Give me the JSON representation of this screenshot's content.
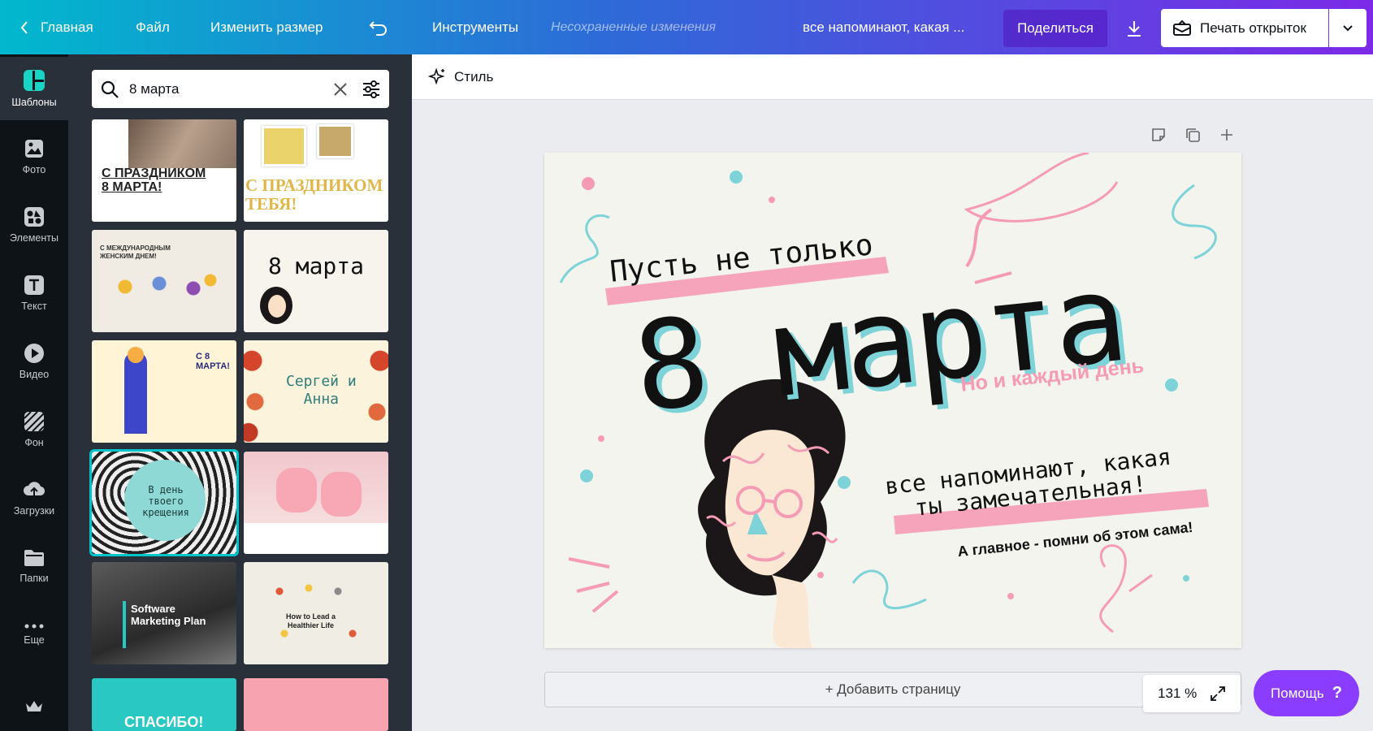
{
  "topbar": {
    "home": "Главная",
    "file": "Файл",
    "resize": "Изменить размер",
    "tools": "Инструменты",
    "unsaved": "Несохраненные изменения",
    "doc_title": "все напоминают, какая ...",
    "share": "Поделиться",
    "print": "Печать открыток",
    "colors": {
      "gradient_start": "#01b8cd",
      "gradient_end": "#7c2ae8"
    }
  },
  "rail": [
    {
      "label": "Шаблоны",
      "icon": "templates-icon"
    },
    {
      "label": "Фото",
      "icon": "photo-icon"
    },
    {
      "label": "Элементы",
      "icon": "elements-icon"
    },
    {
      "label": "Текст",
      "icon": "text-icon"
    },
    {
      "label": "Видео",
      "icon": "video-icon"
    },
    {
      "label": "Фон",
      "icon": "background-icon"
    },
    {
      "label": "Загрузки",
      "icon": "upload-icon"
    },
    {
      "label": "Папки",
      "icon": "folder-icon"
    },
    {
      "label": "Еще",
      "icon": "more-icon"
    }
  ],
  "search": {
    "value": "8 марта"
  },
  "templates": [
    {
      "text1": "С ПРАЗДНИКОМ",
      "text2": "8 МАРТА!"
    },
    {
      "text1": "С ПРАЗДНИКОМ",
      "text2": "ТЕБЯ!"
    },
    {
      "text1": "С МЕЖДУНАРОДНЫМ",
      "text2": "ЖЕНСКИМ ДНЕМ!"
    },
    {
      "text1": "8 марта",
      "text2": ""
    },
    {
      "text1": "С 8",
      "text2": "МАРТА!"
    },
    {
      "text1": "Сергей и",
      "text2": "Анна"
    },
    {
      "text1": "В день",
      "text2": "твоего крещения"
    },
    {
      "text1": "",
      "text2": ""
    },
    {
      "text1": "Software",
      "text2": "Marketing Plan"
    },
    {
      "text1": "How to Lead a",
      "text2": "Healthier Life"
    },
    {
      "text1": "СПАСИБО!",
      "text2": ""
    },
    {
      "text1": "",
      "text2": ""
    }
  ],
  "stylebar": {
    "label": "Стиль"
  },
  "card": {
    "line1": "Пусть не только",
    "title": "8 марта",
    "line2": "Но и каждый день",
    "line3a": "все напоминают, какая",
    "line3b": "ты замечательная!",
    "line4": "А главное - помни об этом сама!"
  },
  "add_page": "+ Добавить страницу",
  "zoom": "131 %",
  "help": "Помощь"
}
